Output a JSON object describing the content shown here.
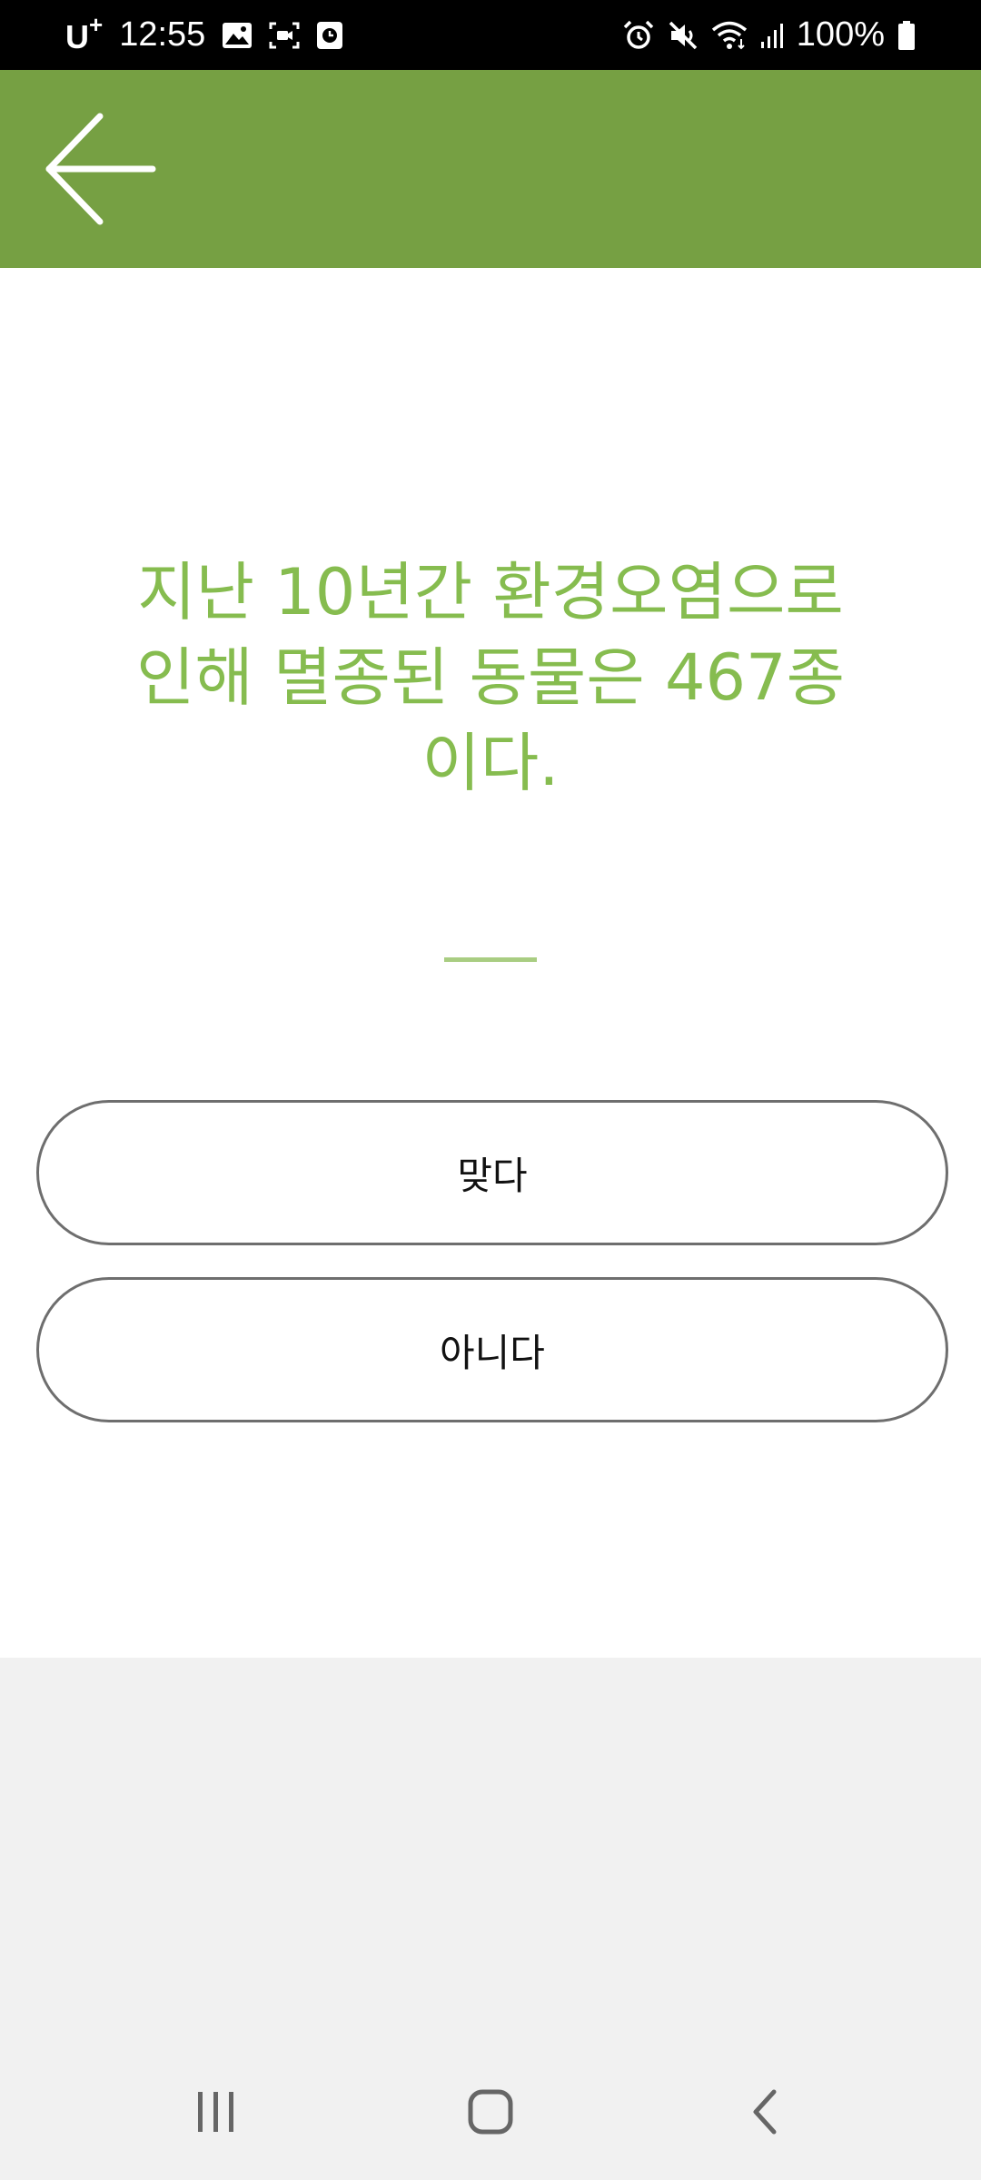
{
  "status_bar": {
    "carrier": "U",
    "carrier_sup": "+",
    "time": "12:55",
    "battery": "100%",
    "icons_left": [
      "gallery-icon",
      "screen-record-icon",
      "clock-app-icon"
    ],
    "icons_right": [
      "alarm-icon",
      "mute-icon",
      "wifi-icon",
      "signal-icon",
      "battery-icon"
    ]
  },
  "app_bar": {
    "background": "#76a043",
    "back_icon": "arrow-left-icon"
  },
  "quiz": {
    "question": "지난 10년간 환경오염으로 인해 멸종된 동물은 467종이다.",
    "question_color": "#86bc4f",
    "answers": [
      {
        "label": "맞다"
      },
      {
        "label": "아니다"
      }
    ]
  },
  "nav_bar": {
    "icons": [
      "recent-apps-icon",
      "home-icon",
      "back-icon"
    ]
  }
}
